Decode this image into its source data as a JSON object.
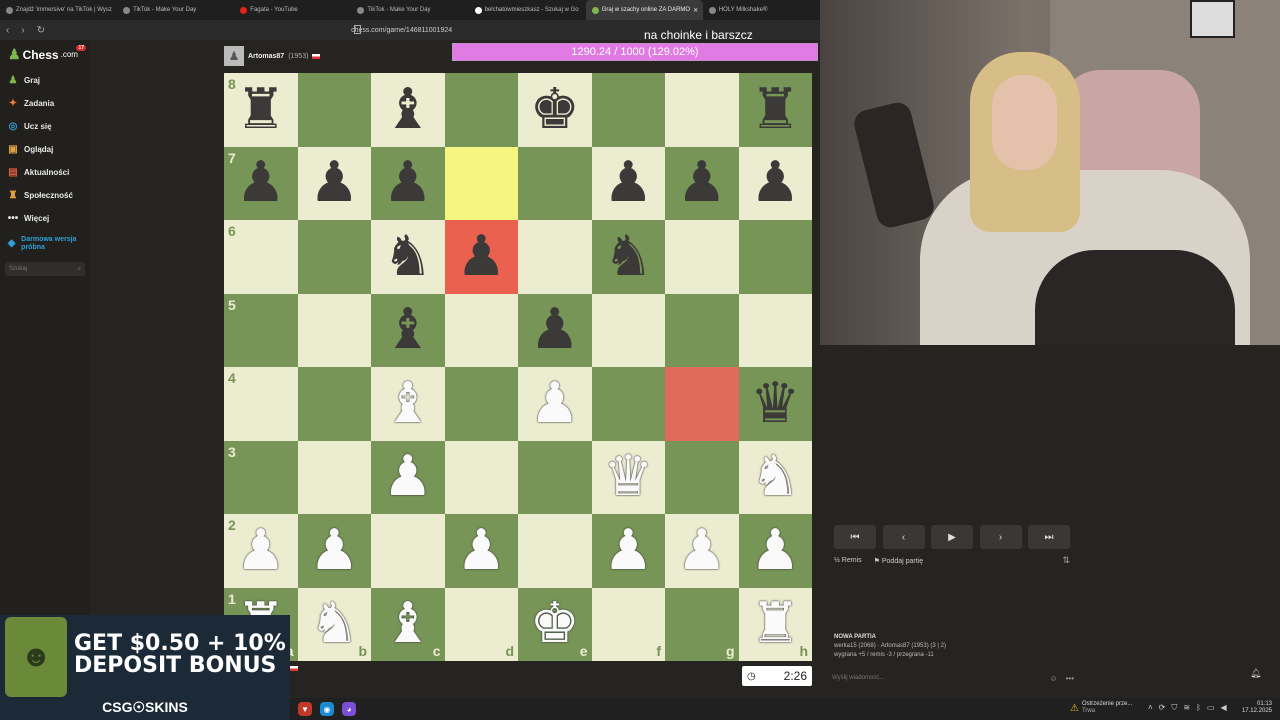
{
  "browser": {
    "tabs": [
      {
        "label": "Znajdź 'immersive' na TikTok | Wysz"
      },
      {
        "label": "TikTok - Make Your Day"
      },
      {
        "label": "Fagata - YouTube"
      },
      {
        "label": "TikTok - Make Your Day"
      },
      {
        "label": "belchatowmieszkasz - Szukaj w Go"
      },
      {
        "label": "Graj w szachy online ZA DARMO"
      },
      {
        "label": "HOLY Milkshake®"
      }
    ],
    "url": "chess.com/game/146811001924"
  },
  "sidebar": {
    "logo_a": "Chess",
    "logo_b": ".com",
    "badge": "17",
    "items": [
      {
        "label": "Graj"
      },
      {
        "label": "Zadania"
      },
      {
        "label": "Ucz się"
      },
      {
        "label": "Oglądaj"
      },
      {
        "label": "Aktualności"
      },
      {
        "label": "Społeczność"
      },
      {
        "label": "Więcej"
      }
    ],
    "trial": "Darmowa wersja próbna",
    "search_placeholder": "Szukaj"
  },
  "overlay": {
    "title": "na choinke i barszcz",
    "progress_text": "1290.24 / 1000 (129.02%)",
    "progress_fraction": 1.0
  },
  "top_player": {
    "name": "Artomas87",
    "rating": "(1953)"
  },
  "board": {
    "ranks": [
      "8",
      "7",
      "6",
      "5",
      "4",
      "3",
      "2",
      "1"
    ],
    "files": [
      "a",
      "b",
      "c",
      "d",
      "e",
      "f",
      "g",
      "h"
    ],
    "position": [
      [
        "bR",
        "",
        "bB",
        "",
        "bK",
        "",
        "",
        "bR"
      ],
      [
        "bP",
        "bP",
        "bP",
        "",
        "",
        "bP",
        "bP",
        "bP"
      ],
      [
        "",
        "",
        "bN",
        "bP",
        "",
        "bN",
        "",
        ""
      ],
      [
        "",
        "",
        "bB",
        "",
        "bP",
        "",
        "",
        ""
      ],
      [
        "",
        "",
        "wB",
        "",
        "wP",
        "",
        "",
        "bQ"
      ],
      [
        "",
        "",
        "wP",
        "",
        "",
        "wQ",
        "",
        "wN"
      ],
      [
        "wP",
        "wP",
        "",
        "wP",
        "",
        "wP",
        "wP",
        "wP"
      ],
      [
        "wR",
        "wN",
        "wB",
        "",
        "wK",
        "",
        "",
        "wR"
      ]
    ],
    "highlight_yellow": "d7",
    "highlight_red": [
      "d6",
      "g4"
    ]
  },
  "clock": {
    "time": "2:26"
  },
  "ad": {
    "line1": "GET $0.50 + 10%",
    "line2": "DEPOSIT BONUS",
    "brand": "CSG☉SKINS"
  },
  "game_panel": {
    "controls": [
      "⏮",
      "‹",
      "▶",
      "›",
      "⏭"
    ],
    "draw_label": "Remis",
    "resign_label": "Poddaj partię",
    "new_game": "NOWA PARTIA",
    "matchup": "werka15 (2068) · Artomas87 (1953) (3 | 2)",
    "result_stats": "wygrana +5 / remis -3 / przegrana -11",
    "chat_placeholder": "Wyślij wiadomość..."
  },
  "taskbar": {
    "warning_title": "Ostrzeżenie prze...",
    "warning_sub": "Trwa",
    "time": "01:13",
    "date": "17.12.2025"
  },
  "colors": {
    "light_square": "#ebecd0",
    "dark_square": "#779556",
    "highlight_yellow": "#f5f682",
    "highlight_red": "#eb6150",
    "progress_fill": "#e07be4",
    "chess_green": "#81b64c"
  }
}
